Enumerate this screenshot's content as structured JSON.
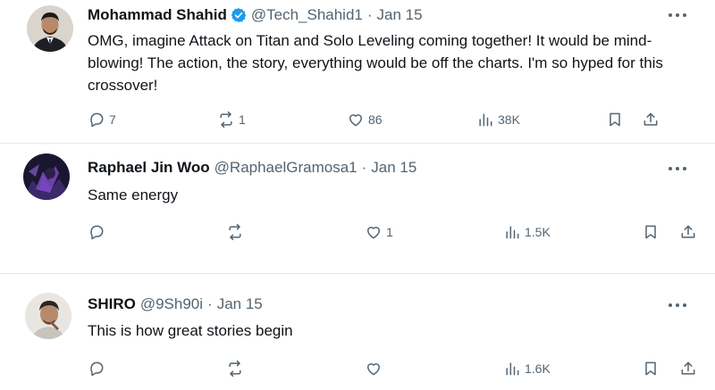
{
  "tweets": [
    {
      "author": "Mohammad Shahid",
      "verified": true,
      "handle": "@Tech_Shahid1",
      "separator": "·",
      "date": "Jan 15",
      "text": "OMG, imagine Attack on Titan and Solo Leveling coming together! It would be mind-blowing! The action, the story, everything would be off the charts. I'm so hyped for this crossover!",
      "replies": "7",
      "reposts": "1",
      "likes": "86",
      "views": "38K"
    },
    {
      "author": "Raphael Jin Woo",
      "verified": false,
      "handle": "@RaphaelGramosa1",
      "separator": "·",
      "date": "Jan 15",
      "text": "Same energy",
      "replies": "",
      "reposts": "",
      "likes": "1",
      "views": "1.5K"
    },
    {
      "author": "SHIRO",
      "verified": false,
      "handle": "@9Sh90i",
      "separator": "·",
      "date": "Jan 15",
      "text": "This is how great stories begin",
      "replies": "",
      "reposts": "",
      "likes": "",
      "views": "1.6K"
    }
  ],
  "colors": {
    "verified_badge": "#1d9bf0",
    "secondary_text": "#536471",
    "divider": "#e6e9eb"
  },
  "icons": [
    "reply-icon",
    "repost-icon",
    "like-icon",
    "views-icon",
    "bookmark-icon",
    "share-icon",
    "more-icon",
    "verified-badge-icon"
  ]
}
